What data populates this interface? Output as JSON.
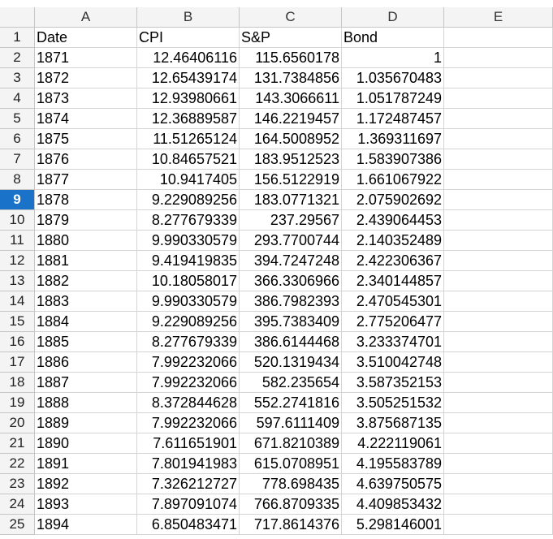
{
  "columns": [
    "A",
    "B",
    "C",
    "D",
    "E"
  ],
  "active_row": 9,
  "rows": [
    {
      "n": "1",
      "a": "Date",
      "b": "CPI",
      "c": "S&P",
      "d": "Bond",
      "e": ""
    },
    {
      "n": "2",
      "a": "1871",
      "b": "12.46406116",
      "c": "115.6560178",
      "d": "1",
      "e": ""
    },
    {
      "n": "3",
      "a": "1872",
      "b": "12.65439174",
      "c": "131.7384856",
      "d": "1.035670483",
      "e": ""
    },
    {
      "n": "4",
      "a": "1873",
      "b": "12.93980661",
      "c": "143.3066611",
      "d": "1.051787249",
      "e": ""
    },
    {
      "n": "5",
      "a": "1874",
      "b": "12.36889587",
      "c": "146.2219457",
      "d": "1.172487457",
      "e": ""
    },
    {
      "n": "6",
      "a": "1875",
      "b": "11.51265124",
      "c": "164.5008952",
      "d": "1.369311697",
      "e": ""
    },
    {
      "n": "7",
      "a": "1876",
      "b": "10.84657521",
      "c": "183.9512523",
      "d": "1.583907386",
      "e": ""
    },
    {
      "n": "8",
      "a": "1877",
      "b": "10.9417405",
      "c": "156.5122919",
      "d": "1.661067922",
      "e": ""
    },
    {
      "n": "9",
      "a": "1878",
      "b": "9.229089256",
      "c": "183.0771321",
      "d": "2.075902692",
      "e": ""
    },
    {
      "n": "10",
      "a": "1879",
      "b": "8.277679339",
      "c": "237.29567",
      "d": "2.439064453",
      "e": ""
    },
    {
      "n": "11",
      "a": "1880",
      "b": "9.990330579",
      "c": "293.7700744",
      "d": "2.140352489",
      "e": ""
    },
    {
      "n": "12",
      "a": "1881",
      "b": "9.419419835",
      "c": "394.7247248",
      "d": "2.422306367",
      "e": ""
    },
    {
      "n": "13",
      "a": "1882",
      "b": "10.18058017",
      "c": "366.3306966",
      "d": "2.340144857",
      "e": ""
    },
    {
      "n": "14",
      "a": "1883",
      "b": "9.990330579",
      "c": "386.7982393",
      "d": "2.470545301",
      "e": ""
    },
    {
      "n": "15",
      "a": "1884",
      "b": "9.229089256",
      "c": "395.7383409",
      "d": "2.775206477",
      "e": ""
    },
    {
      "n": "16",
      "a": "1885",
      "b": "8.277679339",
      "c": "386.6144468",
      "d": "3.233374701",
      "e": ""
    },
    {
      "n": "17",
      "a": "1886",
      "b": "7.992232066",
      "c": "520.1319434",
      "d": "3.510042748",
      "e": ""
    },
    {
      "n": "18",
      "a": "1887",
      "b": "7.992232066",
      "c": "582.235654",
      "d": "3.587352153",
      "e": ""
    },
    {
      "n": "19",
      "a": "1888",
      "b": "8.372844628",
      "c": "552.2741816",
      "d": "3.505251532",
      "e": ""
    },
    {
      "n": "20",
      "a": "1889",
      "b": "7.992232066",
      "c": "597.6111409",
      "d": "3.875687135",
      "e": ""
    },
    {
      "n": "21",
      "a": "1890",
      "b": "7.611651901",
      "c": "671.8210389",
      "d": "4.222119061",
      "e": ""
    },
    {
      "n": "22",
      "a": "1891",
      "b": "7.801941983",
      "c": "615.0708951",
      "d": "4.195583789",
      "e": ""
    },
    {
      "n": "23",
      "a": "1892",
      "b": "7.326212727",
      "c": "778.698435",
      "d": "4.639750575",
      "e": ""
    },
    {
      "n": "24",
      "a": "1893",
      "b": "7.897091074",
      "c": "766.8709335",
      "d": "4.409853432",
      "e": ""
    },
    {
      "n": "25",
      "a": "1894",
      "b": "6.850483471",
      "c": "717.8614376",
      "d": "5.298146001",
      "e": ""
    }
  ]
}
